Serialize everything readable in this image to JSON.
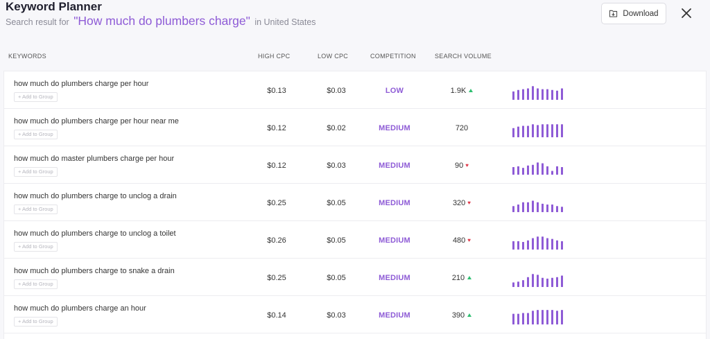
{
  "header": {
    "title": "Keyword Planner",
    "subtitle_prefix": "Search result for",
    "query": "\"How much do plumbers charge\"",
    "subtitle_suffix": "in United States",
    "download_label": "Download"
  },
  "columns": {
    "keywords": "KEYWORDS",
    "high_cpc": "HIGH CPC",
    "low_cpc": "LOW CPC",
    "competition": "COMPETITION",
    "search_volume": "SEARCH VOLUME"
  },
  "add_to_group_label": "+ Add to Group",
  "colors": {
    "accent": "#8e5bd6",
    "trend_up": "#2fbf71",
    "trend_down": "#e0394a",
    "bar": "#8e5bd6"
  },
  "rows": [
    {
      "keyword": "how much do plumbers charge per hour",
      "high_cpc": "$0.13",
      "low_cpc": "$0.03",
      "competition": "LOW",
      "volume": "1.9K",
      "trend": "up",
      "bars": [
        0.55,
        0.65,
        0.7,
        0.75,
        0.9,
        0.75,
        0.7,
        0.7,
        0.65,
        0.6,
        0.75
      ]
    },
    {
      "keyword": "how much do plumbers charge per hour near me",
      "high_cpc": "$0.12",
      "low_cpc": "$0.02",
      "competition": "MEDIUM",
      "volume": "720",
      "trend": "none",
      "bars": [
        0.6,
        0.7,
        0.75,
        0.75,
        0.85,
        0.8,
        0.85,
        0.85,
        0.85,
        0.85,
        0.85
      ]
    },
    {
      "keyword": "how much do master plumbers charge per hour",
      "high_cpc": "$0.12",
      "low_cpc": "$0.03",
      "competition": "MEDIUM",
      "volume": "90",
      "trend": "down",
      "bars": [
        0.5,
        0.55,
        0.45,
        0.6,
        0.65,
        0.8,
        0.75,
        0.55,
        0.25,
        0.55,
        0.5
      ]
    },
    {
      "keyword": "how much do plumbers charge to unclog a drain",
      "high_cpc": "$0.25",
      "low_cpc": "$0.05",
      "competition": "MEDIUM",
      "volume": "320",
      "trend": "down",
      "bars": [
        0.4,
        0.5,
        0.65,
        0.65,
        0.75,
        0.65,
        0.55,
        0.5,
        0.5,
        0.4,
        0.35
      ]
    },
    {
      "keyword": "how much do plumbers charge to unclog a toilet",
      "high_cpc": "$0.26",
      "low_cpc": "$0.05",
      "competition": "MEDIUM",
      "volume": "480",
      "trend": "down",
      "bars": [
        0.55,
        0.55,
        0.5,
        0.6,
        0.75,
        0.85,
        0.85,
        0.75,
        0.7,
        0.6,
        0.55
      ]
    },
    {
      "keyword": "how much do plumbers charge to snake a drain",
      "high_cpc": "$0.25",
      "low_cpc": "$0.05",
      "competition": "MEDIUM",
      "volume": "210",
      "trend": "up",
      "bars": [
        0.3,
        0.35,
        0.45,
        0.65,
        0.85,
        0.8,
        0.6,
        0.55,
        0.6,
        0.65,
        0.75
      ]
    },
    {
      "keyword": "how much do plumbers charge an hour",
      "high_cpc": "$0.14",
      "low_cpc": "$0.03",
      "competition": "MEDIUM",
      "volume": "390",
      "trend": "up",
      "bars": [
        0.7,
        0.7,
        0.75,
        0.75,
        0.9,
        0.95,
        0.95,
        0.95,
        0.95,
        0.9,
        0.95
      ]
    }
  ]
}
